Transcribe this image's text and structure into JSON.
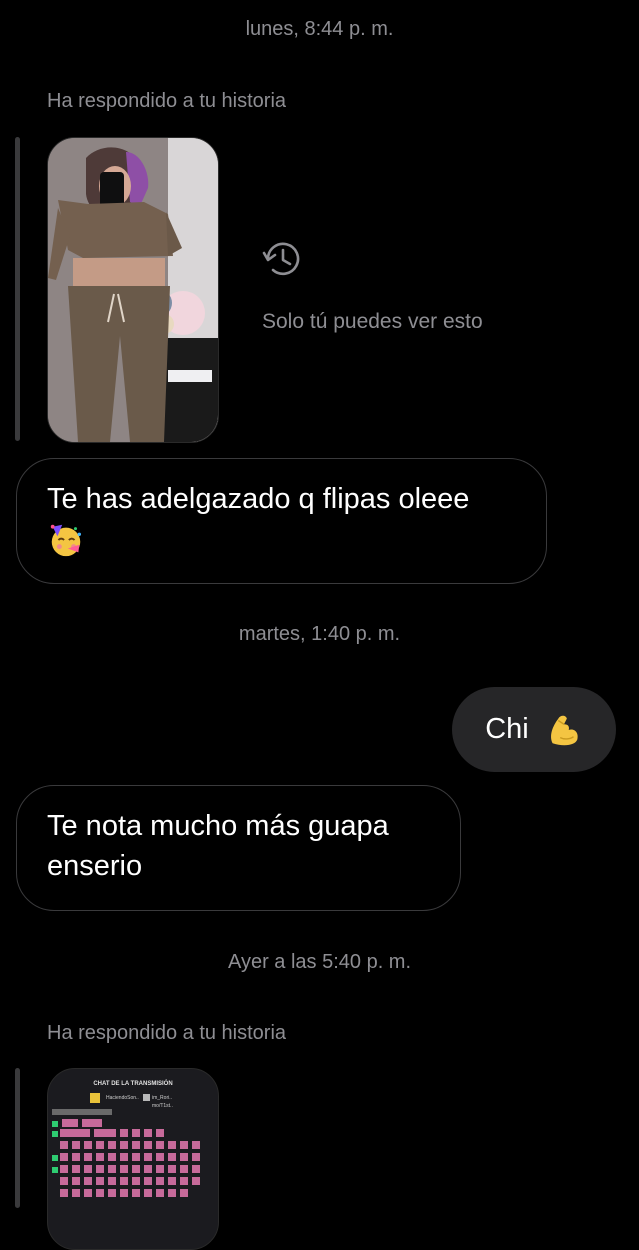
{
  "conversation": {
    "timestamp_1": "lunes, 8:44 p. m.",
    "story_reply_note_1": "Ha respondido a tu historia",
    "private_note": "Solo tú puedes ver esto",
    "message_1": "Te has adelgazado q flipas oleee",
    "message_1_emoji": "partying-face-emoji",
    "timestamp_2": "martes, 1:40 p. m.",
    "message_2": "Chi",
    "message_2_emoji": "flexed-biceps-emoji",
    "message_3": "Te nota mucho más guapa enserio",
    "timestamp_3": "Ayer a las 5:40 p. m.",
    "story_reply_note_2": "Ha respondido a tu historia",
    "stream_story_header": "CHAT DE LA TRANSMISIÓN",
    "stream_story_names": [
      "HaciendoSon..",
      "im_Rori..",
      "mo/T1st.."
    ]
  },
  "colors": {
    "background": "#000000",
    "secondary_text": "#8e8e93",
    "incoming_bubble_border": "#3a3a3c",
    "outgoing_bubble": "#262628"
  }
}
